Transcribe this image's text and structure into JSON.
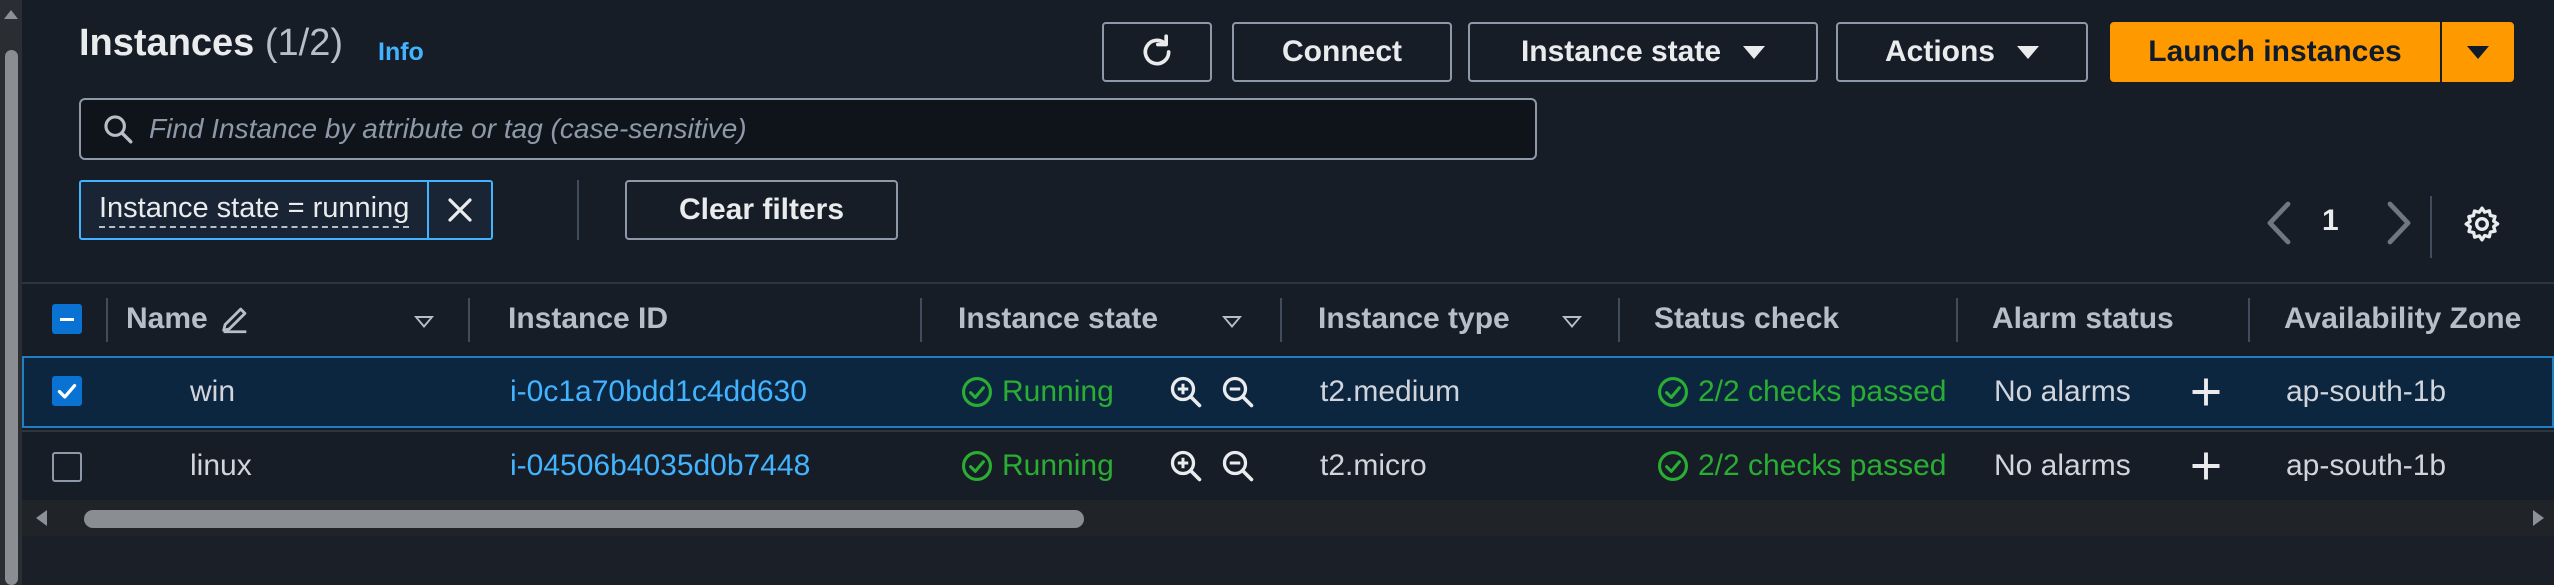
{
  "header": {
    "title": "Instances",
    "count": "(1/2)",
    "info_label": "Info",
    "connect_label": "Connect",
    "instance_state_label": "Instance state",
    "actions_label": "Actions",
    "launch_label": "Launch instances"
  },
  "search": {
    "placeholder": "Find Instance by attribute or tag (case-sensitive)"
  },
  "filters": {
    "token_label": "Instance state = running",
    "clear_label": "Clear filters"
  },
  "pagination": {
    "current_page": "1"
  },
  "table": {
    "columns": {
      "name": "Name",
      "instance_id": "Instance ID",
      "instance_state": "Instance state",
      "instance_type": "Instance type",
      "status_check": "Status check",
      "alarm_status": "Alarm status",
      "availability_zone": "Availability Zone"
    },
    "rows": [
      {
        "name": "win",
        "instance_id": "i-0c1a70bdd1c4dd630",
        "state": "Running",
        "type": "t2.medium",
        "status_check": "2/2 checks passed",
        "alarm": "No alarms",
        "zone": "ap-south-1b",
        "selected": true
      },
      {
        "name": "linux",
        "instance_id": "i-04506b4035d0b7448",
        "state": "Running",
        "type": "t2.micro",
        "status_check": "2/2 checks passed",
        "alarm": "No alarms",
        "zone": "ap-south-1b",
        "selected": false
      }
    ]
  },
  "colors": {
    "accent_orange": "#ff9900",
    "link_blue": "#42b4ff",
    "success_green": "#29ad32",
    "background": "#161d26"
  },
  "icons": [
    "refresh-icon",
    "search-icon",
    "close-icon",
    "chevron-left-icon",
    "chevron-right-icon",
    "gear-icon",
    "edit-icon",
    "zoom-in-icon",
    "zoom-out-icon",
    "plus-icon",
    "check-circle-icon"
  ]
}
